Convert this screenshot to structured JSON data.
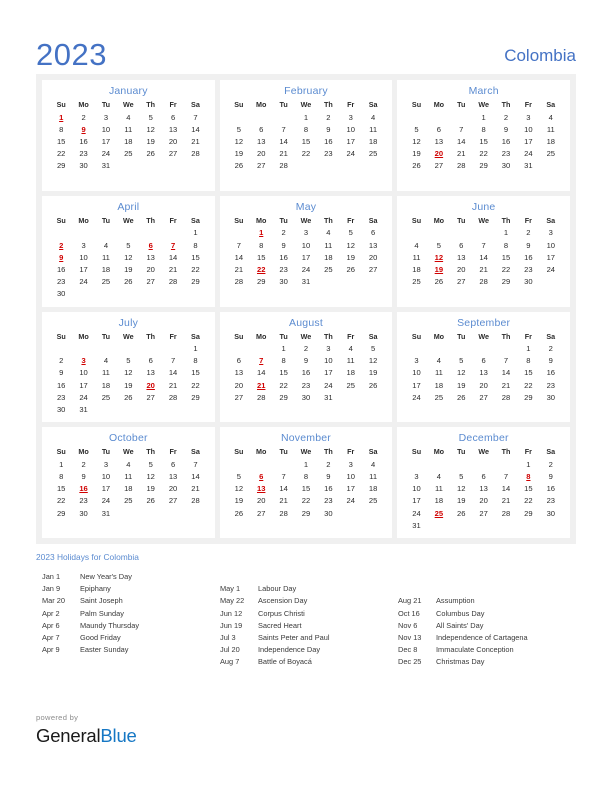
{
  "header": {
    "year": "2023",
    "country": "Colombia"
  },
  "colors": {
    "accent": "#4472c4",
    "month_title": "#5b8bd0",
    "holiday": "#d00000",
    "board_bg": "#f0f0f0",
    "card_bg": "#ffffff",
    "logo_blue": "#1577c4"
  },
  "weekdays": [
    "Su",
    "Mo",
    "Tu",
    "We",
    "Th",
    "Fr",
    "Sa"
  ],
  "months": [
    {
      "name": "January",
      "first_weekday": 0,
      "days": 31,
      "holidays": [
        1,
        9
      ]
    },
    {
      "name": "February",
      "first_weekday": 3,
      "days": 28,
      "holidays": []
    },
    {
      "name": "March",
      "first_weekday": 3,
      "days": 31,
      "holidays": [
        20
      ]
    },
    {
      "name": "April",
      "first_weekday": 6,
      "days": 30,
      "holidays": [
        2,
        6,
        7,
        9
      ]
    },
    {
      "name": "May",
      "first_weekday": 1,
      "days": 31,
      "holidays": [
        1,
        22
      ]
    },
    {
      "name": "June",
      "first_weekday": 4,
      "days": 30,
      "holidays": [
        12,
        19
      ]
    },
    {
      "name": "July",
      "first_weekday": 6,
      "days": 31,
      "holidays": [
        3,
        20
      ]
    },
    {
      "name": "August",
      "first_weekday": 2,
      "days": 31,
      "holidays": [
        7,
        21
      ]
    },
    {
      "name": "September",
      "first_weekday": 5,
      "days": 30,
      "holidays": []
    },
    {
      "name": "October",
      "first_weekday": 0,
      "days": 31,
      "holidays": [
        16
      ]
    },
    {
      "name": "November",
      "first_weekday": 3,
      "days": 30,
      "holidays": [
        6,
        13
      ]
    },
    {
      "name": "December",
      "first_weekday": 5,
      "days": 31,
      "holidays": [
        8,
        25
      ]
    }
  ],
  "holidays_section": {
    "heading": "2023 Holidays for Colombia",
    "columns": [
      {
        "offset": 0,
        "items": [
          {
            "date": "Jan 1",
            "name": "New Year's Day"
          },
          {
            "date": "Jan 9",
            "name": "Epiphany"
          },
          {
            "date": "Mar 20",
            "name": "Saint Joseph"
          },
          {
            "date": "Apr 2",
            "name": "Palm Sunday"
          },
          {
            "date": "Apr 6",
            "name": "Maundy Thursday"
          },
          {
            "date": "Apr 7",
            "name": "Good Friday"
          },
          {
            "date": "Apr 9",
            "name": "Easter Sunday"
          }
        ]
      },
      {
        "offset": 1,
        "items": [
          {
            "date": "May 1",
            "name": "Labour Day"
          },
          {
            "date": "May 22",
            "name": "Ascension Day"
          },
          {
            "date": "Jun 12",
            "name": "Corpus Christi"
          },
          {
            "date": "Jun 19",
            "name": "Sacred Heart"
          },
          {
            "date": "Jul 3",
            "name": "Saints Peter and Paul"
          },
          {
            "date": "Jul 20",
            "name": "Independence Day"
          },
          {
            "date": "Aug 7",
            "name": "Battle of Boyacá"
          }
        ]
      },
      {
        "offset": 2,
        "items": [
          {
            "date": "Aug 21",
            "name": "Assumption"
          },
          {
            "date": "Oct 16",
            "name": "Columbus Day"
          },
          {
            "date": "Nov 6",
            "name": "All Saints' Day"
          },
          {
            "date": "Nov 13",
            "name": "Independence of Cartagena"
          },
          {
            "date": "Dec 8",
            "name": "Immaculate Conception"
          },
          {
            "date": "Dec 25",
            "name": "Christmas Day"
          }
        ]
      }
    ]
  },
  "footer": {
    "powered_by": "powered by",
    "logo_first": "General",
    "logo_second": "Blue"
  }
}
